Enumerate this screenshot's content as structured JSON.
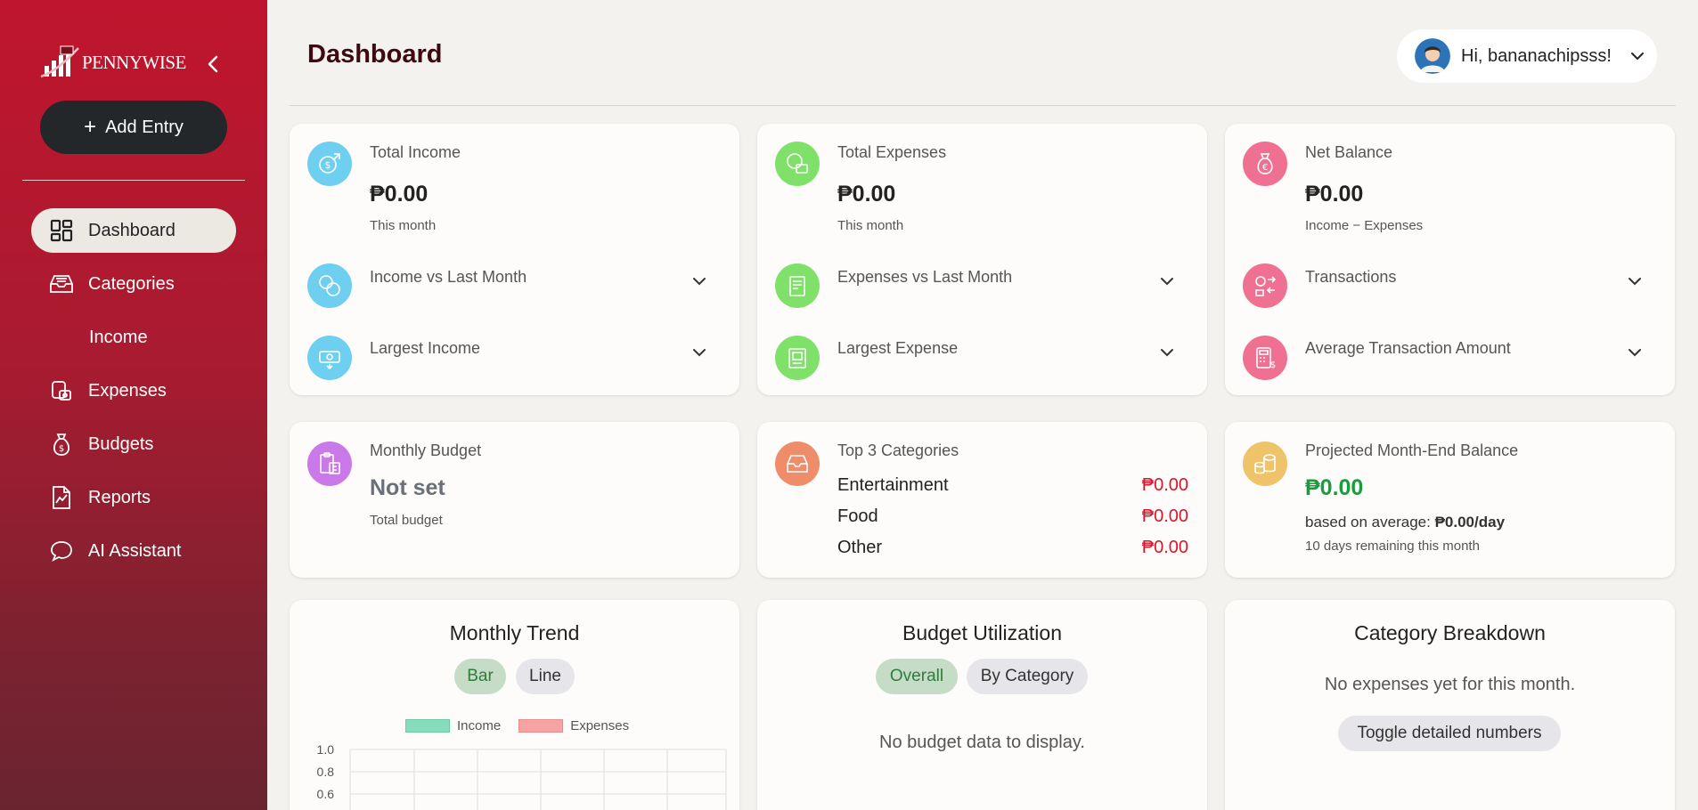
{
  "app": {
    "brand": "PENNYWISE"
  },
  "sidebar": {
    "add_label": "Add Entry",
    "items": [
      {
        "label": "Dashboard",
        "icon": "dashboard-grid-icon"
      },
      {
        "label": "Categories",
        "icon": "inbox-tray-icon"
      },
      {
        "label": "Income",
        "icon": ""
      },
      {
        "label": "Expenses",
        "icon": "wallet-icon"
      },
      {
        "label": "Budgets",
        "icon": "money-bag-icon"
      },
      {
        "label": "Reports",
        "icon": "report-chart-icon"
      },
      {
        "label": "AI Assistant",
        "icon": "chat-bubble-icon"
      }
    ]
  },
  "header": {
    "title": "Dashboard",
    "greeting": "Hi, bananachipsss!"
  },
  "summary": {
    "income": {
      "label": "Total Income",
      "value": "₱0.00",
      "sub": "This month",
      "row1": "Income vs Last Month",
      "row2": "Largest Income"
    },
    "expenses": {
      "label": "Total Expenses",
      "value": "₱0.00",
      "sub": "This month",
      "row1": "Expenses vs Last Month",
      "row2": "Largest Expense"
    },
    "balance": {
      "label": "Net Balance",
      "value": "₱0.00",
      "sub": "Income − Expenses",
      "row1": "Transactions",
      "row2": "Average Transaction Amount"
    }
  },
  "budget": {
    "label": "Monthly Budget",
    "value": "Not set",
    "sub": "Total budget"
  },
  "top_categories": {
    "label": "Top 3 Categories",
    "items": [
      {
        "name": "Entertainment",
        "amount": "₱0.00"
      },
      {
        "name": "Food",
        "amount": "₱0.00"
      },
      {
        "name": "Other",
        "amount": "₱0.00"
      }
    ]
  },
  "projected": {
    "label": "Projected Month-End Balance",
    "value": "₱0.00",
    "avg_prefix": "based on average:",
    "avg_value": "₱0.00/day",
    "remaining": "10 days remaining this month"
  },
  "trend": {
    "title": "Monthly Trend",
    "toggle_bar": "Bar",
    "toggle_line": "Line",
    "legend_income": "Income",
    "legend_expenses": "Expenses",
    "ticks": [
      "1.0",
      "0.8",
      "0.6"
    ],
    "colors": {
      "income": "#87dcbc",
      "expenses": "#f6a3a3"
    }
  },
  "utilization": {
    "title": "Budget Utilization",
    "toggle_overall": "Overall",
    "toggle_category": "By Category",
    "empty": "No budget data to display."
  },
  "breakdown": {
    "title": "Category Breakdown",
    "empty": "No expenses yet for this month.",
    "toggle": "Toggle detailed numbers"
  },
  "colors": {
    "accent": "#c0152e",
    "positive": "#1a9c3c",
    "negative": "#d7182a"
  }
}
